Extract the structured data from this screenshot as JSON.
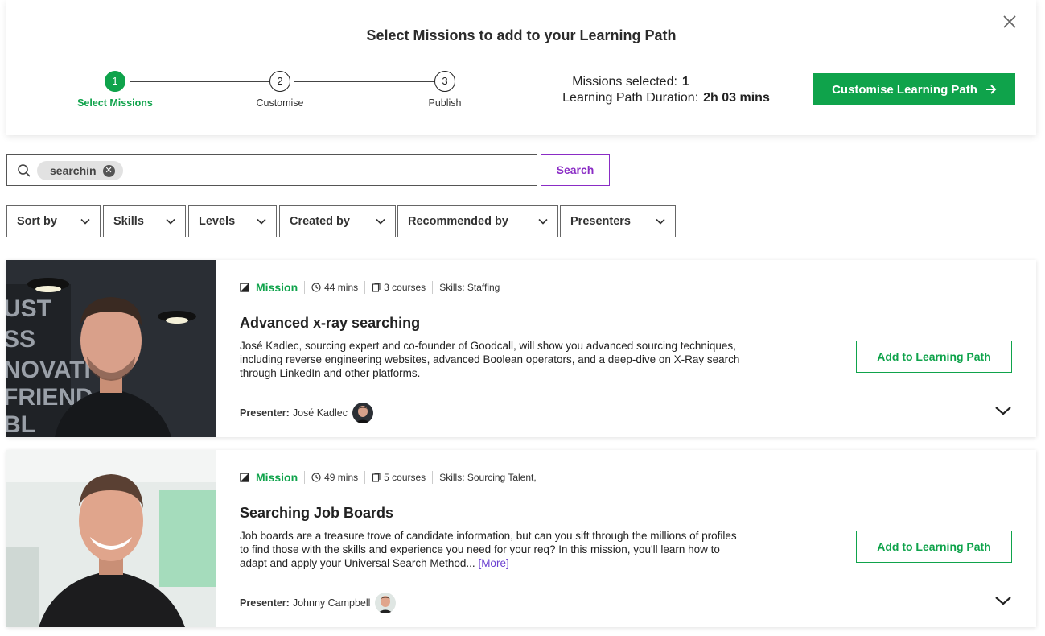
{
  "header": {
    "title": "Select Missions to add to your Learning Path",
    "steps": [
      {
        "number": "1",
        "label": "Select Missions"
      },
      {
        "number": "2",
        "label": "Customise"
      },
      {
        "number": "3",
        "label": "Publish"
      }
    ],
    "active_step": 1,
    "missions_selected_label": "Missions selected:",
    "missions_selected_value": "1",
    "duration_label": "Learning Path Duration:",
    "duration_value": "2h 03 mins",
    "primary_button": "Customise Learning Path",
    "close_icon": "close-icon"
  },
  "search": {
    "chip": "searchin",
    "button": "Search"
  },
  "filters": [
    "Sort by",
    "Skills",
    "Levels",
    "Created by",
    "Recommended by",
    "Presenters"
  ],
  "missions": [
    {
      "type": "Mission",
      "duration": "44 mins",
      "courses": "3 courses",
      "skills": "Skills: Staffing",
      "title": "Advanced x-ray searching",
      "description": "José Kadlec, sourcing expert and co-founder of Goodcall, will show you advanced sourcing techniques, including reverse engineering websites, advanced Boolean operators, and a deep-dive on X-Ray search through LinkedIn and other platforms.",
      "more": "",
      "presenter_label": "Presenter:",
      "presenter": "José Kadlec",
      "add_button": "Add to Learning Path"
    },
    {
      "type": "Mission",
      "duration": "49 mins",
      "courses": "5 courses",
      "skills": "Skills: Sourcing Talent,",
      "title": "Searching Job Boards",
      "description": "Job boards are a treasure trove of candidate information, but can you sift through the millions of profiles to find those with the skills and experience you need for your req? In this mission, you'll learn how to adapt and apply your Universal Search Method...",
      "more": "[More]",
      "presenter_label": "Presenter:",
      "presenter": "Johnny Campbell",
      "add_button": "Add to Learning Path"
    }
  ],
  "colors": {
    "brand_green": "#0fa34b",
    "search_purple": "#8a2cc5",
    "link_purple": "#6a3fd0"
  }
}
